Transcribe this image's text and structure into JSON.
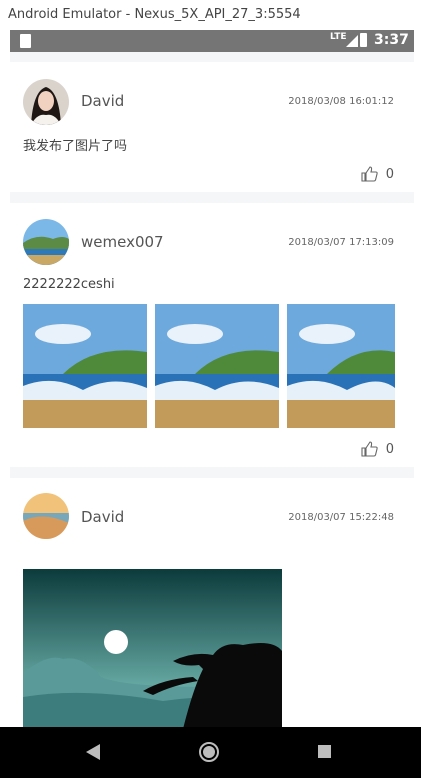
{
  "window": {
    "title": "Android Emulator - Nexus_5X_API_27_3:5554"
  },
  "status_bar": {
    "network": "LTE",
    "time": "3:37"
  },
  "colors": {
    "status_bar": "#757575",
    "background": "#f4f6f8",
    "nav_bar": "#000000"
  },
  "posts": [
    {
      "username": "David",
      "timestamp": "2018/03/08 16:01:12",
      "content": "我发布了图片了吗",
      "likes": "0",
      "avatar_icon": "person-avatar-icon"
    },
    {
      "username": "wemex007",
      "timestamp": "2018/03/07 17:13:09",
      "content": "2222222ceshi",
      "likes": "0",
      "avatar_icon": "beach-avatar-icon",
      "images": [
        "beach-photo",
        "beach-photo",
        "beach-photo"
      ]
    },
    {
      "username": "David",
      "timestamp": "2018/03/07 15:22:48",
      "content": "",
      "avatar_icon": "sunset-avatar-icon",
      "images": [
        "tree-silhouette-photo"
      ]
    }
  ],
  "nav_bar": {
    "back_icon": "back-triangle-icon",
    "home_icon": "home-circle-icon",
    "recents_icon": "recents-square-icon"
  }
}
